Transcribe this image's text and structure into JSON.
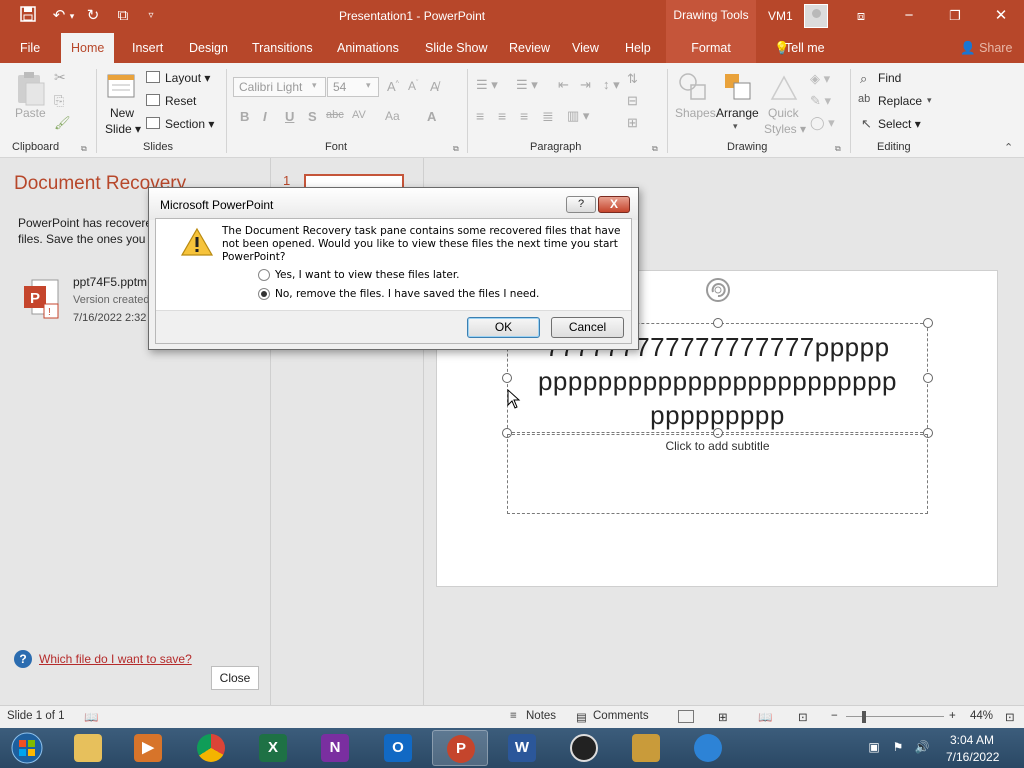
{
  "titlebar": {
    "title": "Presentation1  -  PowerPoint",
    "contextual": "Drawing Tools",
    "user": "VM1",
    "qat_icons": [
      "save-icon",
      "undo-icon",
      "redo-icon",
      "present-icon",
      "customize-icon"
    ]
  },
  "tabs": [
    "File",
    "Home",
    "Insert",
    "Design",
    "Transitions",
    "Animations",
    "Slide Show",
    "Review",
    "View",
    "Help",
    "Format"
  ],
  "tell_me": "Tell me",
  "share": "Share",
  "ribbon": {
    "clipboard": {
      "label": "Clipboard",
      "paste": "Paste"
    },
    "slides": {
      "label": "Slides",
      "new_slide": "New",
      "new_slide2": "Slide",
      "layout": "Layout",
      "reset": "Reset",
      "section": "Section"
    },
    "font": {
      "label": "Font",
      "font_name": "Calibri Light",
      "font_size": "54",
      "bold": "B",
      "italic": "I",
      "underline": "U",
      "shadow": "S",
      "strike": "abc",
      "spacing": "AV",
      "case": "Aa",
      "color": "A"
    },
    "paragraph": {
      "label": "Paragraph"
    },
    "drawing": {
      "label": "Drawing",
      "shapes": "Shapes",
      "arrange": "Arrange",
      "quick": "Quick",
      "styles": "Styles"
    },
    "editing": {
      "label": "Editing",
      "find": "Find",
      "replace": "Replace",
      "select": "Select"
    }
  },
  "recovery": {
    "title": "Document Recovery",
    "desc_line1": "PowerPoint has recovered",
    "desc_line2": "files.  Save the ones you",
    "file_name": "ppt74F5.pptm",
    "file_version": "Version created",
    "file_date": "7/16/2022 2:32",
    "help_link": "Which file do I want to save?",
    "close": "Close"
  },
  "thumbs": {
    "number": "1"
  },
  "slide": {
    "title_text": "7777777777777777777ppppppppppppppppppppppppppppppppppppppp",
    "title_line1": "777777777777777777ppppp",
    "title_line2": "pppppppppppppppppppppppp",
    "title_line3": "ppppppppp",
    "subtitle_placeholder": "Click to add subtitle"
  },
  "dialog": {
    "title": "Microsoft PowerPoint",
    "help_btn": "?",
    "close_btn": "X",
    "message": "The Document Recovery task pane contains some recovered files that have not been opened.  Would you like to view these files the next time you start PowerPoint?",
    "option1": "Yes, I want to view these files later.",
    "option2": "No, remove the files.  I have saved the files I need.",
    "selected_option": 2,
    "ok": "OK",
    "cancel": "Cancel"
  },
  "statusbar": {
    "slide_info": "Slide 1 of 1",
    "notes": "Notes",
    "comments": "Comments",
    "zoom_minus": "−",
    "zoom_plus": "+",
    "zoom": "44%",
    "zoom_level_fraction": 0.44
  },
  "taskbar": {
    "time": "3:04 AM",
    "date": "7/16/2022",
    "apps": [
      {
        "name": "file-explorer",
        "label": ""
      },
      {
        "name": "media-player",
        "label": "▶"
      },
      {
        "name": "chrome",
        "label": ""
      },
      {
        "name": "excel",
        "label": "X"
      },
      {
        "name": "onenote",
        "label": "N"
      },
      {
        "name": "outlook",
        "label": "O"
      },
      {
        "name": "powerpoint",
        "label": "P"
      },
      {
        "name": "word",
        "label": "W"
      },
      {
        "name": "obs",
        "label": ""
      },
      {
        "name": "app-10",
        "label": ""
      },
      {
        "name": "app-11",
        "label": ""
      }
    ]
  },
  "colors": {
    "accent": "#b7472a",
    "contextual": "#c5553a",
    "taskbar": "#2f4f6d"
  }
}
